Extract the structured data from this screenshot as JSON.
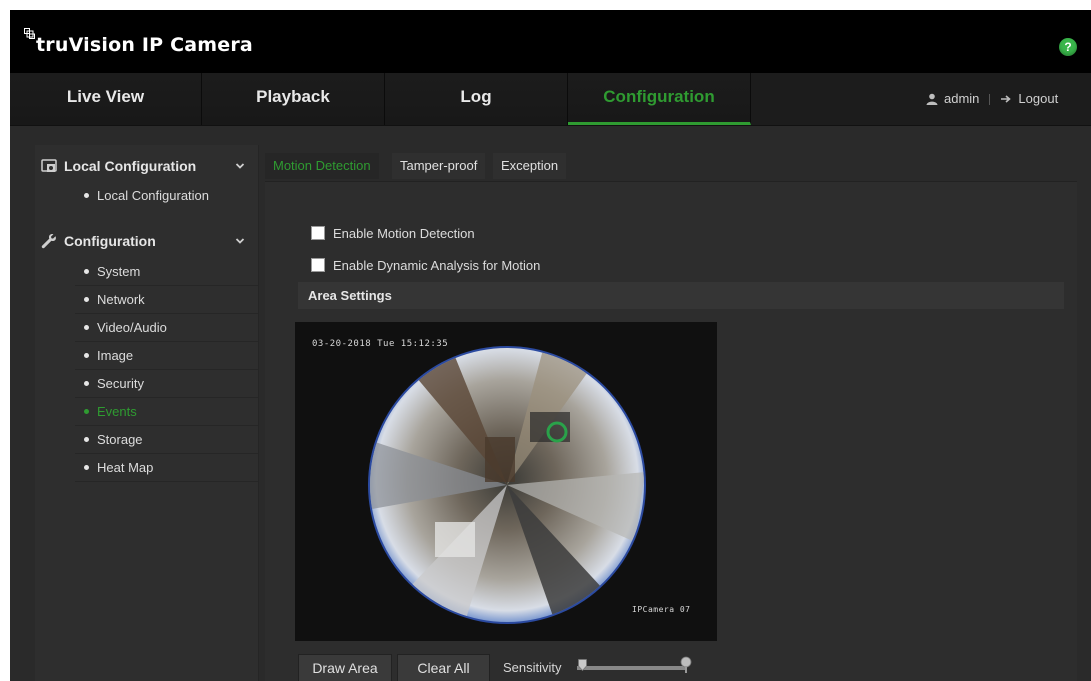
{
  "app": {
    "title": "truVision IP Camera"
  },
  "nav": {
    "tabs": [
      {
        "label": "Live View",
        "active": false
      },
      {
        "label": "Playback",
        "active": false
      },
      {
        "label": "Log",
        "active": false
      },
      {
        "label": "Configuration",
        "active": true
      }
    ],
    "user": "admin",
    "logout": "Logout"
  },
  "sidebar": {
    "groups": [
      {
        "label": "Local Configuration",
        "icon": "local-config-icon",
        "items": [
          {
            "label": "Local Configuration",
            "active": false
          }
        ]
      },
      {
        "label": "Configuration",
        "icon": "wrench-icon",
        "items": [
          {
            "label": "System",
            "active": false
          },
          {
            "label": "Network",
            "active": false
          },
          {
            "label": "Video/Audio",
            "active": false
          },
          {
            "label": "Image",
            "active": false
          },
          {
            "label": "Security",
            "active": false
          },
          {
            "label": "Events",
            "active": true
          },
          {
            "label": "Storage",
            "active": false
          },
          {
            "label": "Heat Map",
            "active": false
          }
        ]
      }
    ]
  },
  "main": {
    "subtabs": [
      {
        "label": "Motion Detection",
        "active": true
      },
      {
        "label": "Tamper-proof",
        "active": false
      },
      {
        "label": "Exception",
        "active": false
      }
    ],
    "checkboxes": [
      {
        "label": "Enable Motion Detection",
        "checked": false
      },
      {
        "label": "Enable Dynamic Analysis for Motion",
        "checked": false
      }
    ],
    "area_settings": "Area Settings",
    "camera": {
      "timestamp": "03-20-2018 Tue 15:12:35",
      "name": "IPCamera 07"
    },
    "controls": {
      "draw_area": "Draw Area",
      "clear_all": "Clear All",
      "sensitivity_label": "Sensitivity",
      "sensitivity_level": 0
    }
  },
  "colors": {
    "accent": "#2f9b31",
    "help": "#39b54a",
    "header_bg": "#000000",
    "panel_bg": "#2d2d2d"
  }
}
